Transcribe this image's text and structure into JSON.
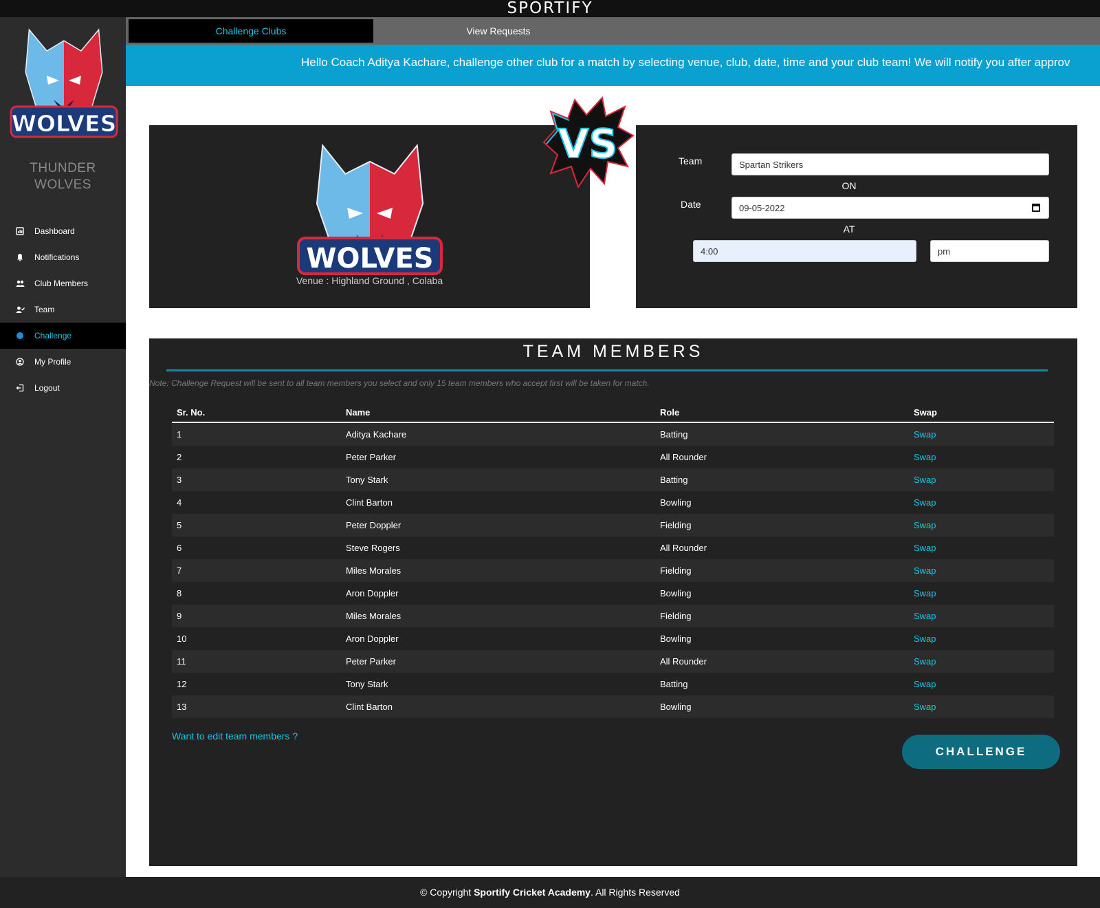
{
  "app": {
    "brand": "SPORTIFY"
  },
  "sidebar": {
    "logo_text": "WOLVES",
    "club_name_line1": "THUNDER",
    "club_name_line2": "WOLVES",
    "items": [
      {
        "label": "Dashboard",
        "icon": "dashboard-icon"
      },
      {
        "label": "Notifications",
        "icon": "bell-icon"
      },
      {
        "label": "Club Members",
        "icon": "users-icon"
      },
      {
        "label": "Team",
        "icon": "user-check-icon"
      },
      {
        "label": "Challenge",
        "icon": "circle-icon",
        "active": true
      },
      {
        "label": "My Profile",
        "icon": "user-circle-icon"
      },
      {
        "label": "Logout",
        "icon": "logout-icon"
      }
    ]
  },
  "tabs": {
    "challenge": "Challenge Clubs",
    "requests": "View Requests"
  },
  "banner": {
    "text": "Hello Coach Aditya Kachare, challenge other club for a match by selecting venue, club, date, time and your club team! We will notify you after approv"
  },
  "opponent": {
    "logo_text": "WOLVES",
    "venue": "Venue : Highland Ground , Colaba"
  },
  "vs_label": "VS",
  "form": {
    "team_label": "Team",
    "team_value": "Spartan Strikers",
    "on_label": "ON",
    "date_label": "Date",
    "date_value": "09-05-2022",
    "at_label": "AT",
    "time_value": "4:00",
    "ampm_value": "pm"
  },
  "members": {
    "title": "TEAM MEMBERS",
    "note": "Note: Challenge Request will be sent to all team members you select and only 15 team members who accept first will be taken for match.",
    "columns": {
      "sr": "Sr. No.",
      "name": "Name",
      "role": "Role",
      "swap": "Swap"
    },
    "rows": [
      {
        "sr": "1",
        "name": "Aditya Kachare",
        "role": "Batting",
        "swap": "Swap"
      },
      {
        "sr": "2",
        "name": "Peter Parker",
        "role": "All Rounder",
        "swap": "Swap"
      },
      {
        "sr": "3",
        "name": "Tony Stark",
        "role": "Batting",
        "swap": "Swap"
      },
      {
        "sr": "4",
        "name": "Clint Barton",
        "role": "Bowling",
        "swap": "Swap"
      },
      {
        "sr": "5",
        "name": "Peter Doppler",
        "role": "Fielding",
        "swap": "Swap"
      },
      {
        "sr": "6",
        "name": "Steve Rogers",
        "role": "All Rounder",
        "swap": "Swap"
      },
      {
        "sr": "7",
        "name": "Miles Morales",
        "role": "Fielding",
        "swap": "Swap"
      },
      {
        "sr": "8",
        "name": "Aron Doppler",
        "role": "Bowling",
        "swap": "Swap"
      },
      {
        "sr": "9",
        "name": "Miles Morales",
        "role": "Fielding",
        "swap": "Swap"
      },
      {
        "sr": "10",
        "name": "Aron Doppler",
        "role": "Bowling",
        "swap": "Swap"
      },
      {
        "sr": "11",
        "name": "Peter Parker",
        "role": "All Rounder",
        "swap": "Swap"
      },
      {
        "sr": "12",
        "name": "Tony Stark",
        "role": "Batting",
        "swap": "Swap"
      },
      {
        "sr": "13",
        "name": "Clint Barton",
        "role": "Bowling",
        "swap": "Swap"
      }
    ],
    "edit_link": "Want to edit team members ?",
    "challenge_button": "CHALLENGE"
  },
  "footer": {
    "prefix": "© Copyright ",
    "company": "Sportify Cricket Academy",
    "suffix": ". All Rights Reserved"
  },
  "colors": {
    "accent": "#1ec3e6",
    "banner": "#0aa0d0",
    "button": "#0e6c80",
    "panel": "#222222"
  }
}
